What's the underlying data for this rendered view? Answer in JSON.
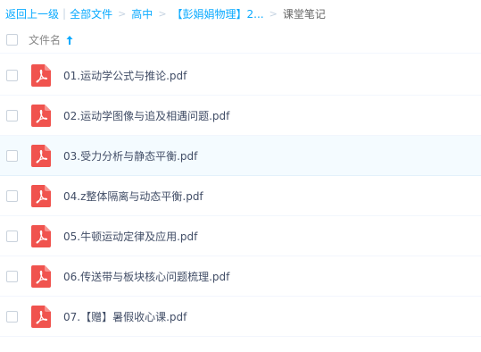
{
  "breadcrumb": {
    "back": "返回上一级",
    "root": "全部文件",
    "level1": "高中",
    "level2": "【彭娟娟物理】2...",
    "current": "课堂笔记"
  },
  "header": {
    "filename_label": "文件名",
    "sort_icon": "arrow-up-icon"
  },
  "files": [
    {
      "name": "01.运动学公式与推论.pdf",
      "icon": "pdf-icon"
    },
    {
      "name": "02.运动学图像与追及相遇问题.pdf",
      "icon": "pdf-icon"
    },
    {
      "name": "03.受力分析与静态平衡.pdf",
      "icon": "pdf-icon"
    },
    {
      "name": "04.z整体隔离与动态平衡.pdf",
      "icon": "pdf-icon"
    },
    {
      "name": "05.牛顿运动定律及应用.pdf",
      "icon": "pdf-icon"
    },
    {
      "name": "06.传送带与板块核心问题梳理.pdf",
      "icon": "pdf-icon"
    },
    {
      "name": "07.【赠】暑假收心课.pdf",
      "icon": "pdf-icon"
    }
  ],
  "colors": {
    "link": "#09aaff",
    "pdf_red": "#f0534e",
    "hover_row": "#f4fbff"
  }
}
